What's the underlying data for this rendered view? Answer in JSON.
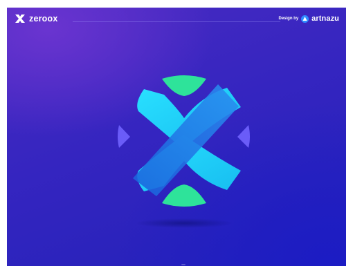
{
  "header": {
    "brand_name": "zeroox",
    "credit_label": "Design by",
    "credit_name": "artnazu"
  },
  "icons": {
    "brand_logo": "zeroox-x-logo-icon",
    "designer_logo": "artnazu-logo-icon"
  },
  "colors": {
    "background_dark": "#2221b9",
    "background_light": "#6a34d0",
    "cyan": "#22d4f5",
    "blue": "#1f7be8",
    "green": "#2ee39a",
    "violet": "#6b57f5"
  }
}
